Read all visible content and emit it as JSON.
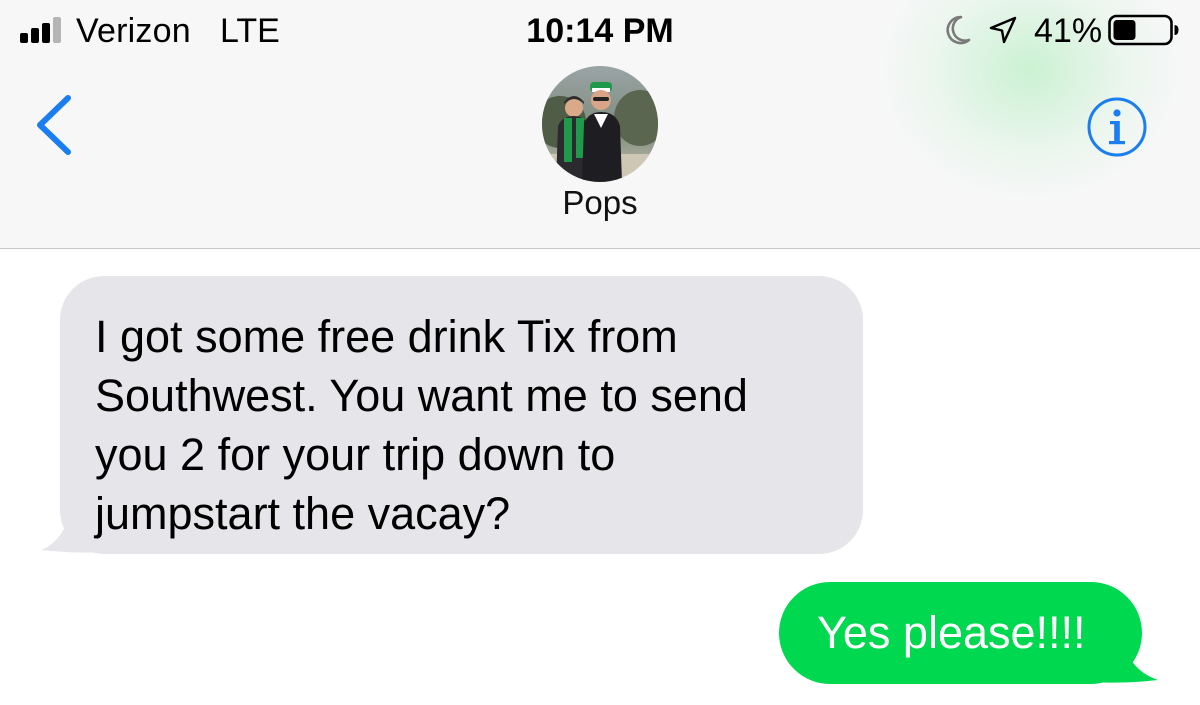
{
  "status_bar": {
    "carrier": "Verizon",
    "network": "LTE",
    "time": "10:14 PM",
    "battery_percent": "41%",
    "battery_level": 0.41,
    "icons": [
      "signal-icon",
      "moon-icon",
      "location-icon",
      "battery-icon"
    ]
  },
  "nav": {
    "back_icon": "chevron-left-icon",
    "contact_name": "Pops",
    "info_icon": "info-icon",
    "accent_color": "#1a7df0"
  },
  "messages": [
    {
      "direction": "incoming",
      "text": "I got some free drink Tix from\nSouthwest. You want me to send\nyou 2 for your trip down to\njumpstart the vacay?",
      "bubble_color": "#e5e5ea"
    },
    {
      "direction": "outgoing",
      "text": "Yes please!!!!",
      "bubble_color": "#00d94f"
    }
  ]
}
